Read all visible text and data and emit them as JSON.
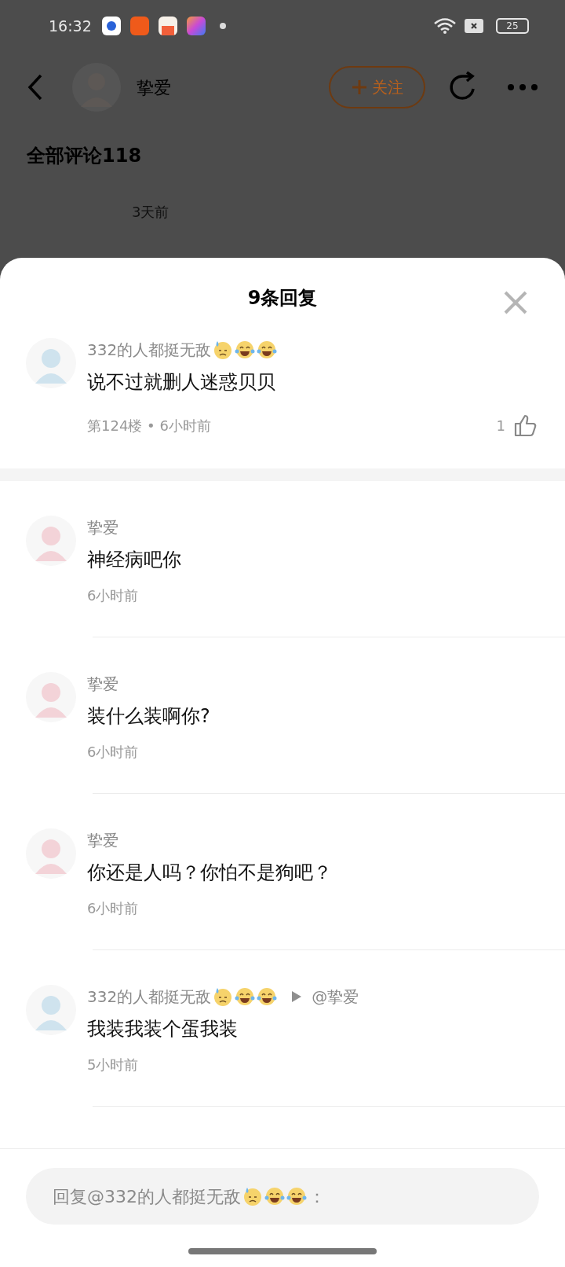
{
  "status_bar": {
    "time": "16:32",
    "battery": "25"
  },
  "header": {
    "name": "挚爱",
    "follow_button": "关注"
  },
  "page": {
    "comments_heading": "全部评论118",
    "timestamp": "3天前"
  },
  "sheet": {
    "title": "9条回复",
    "root_comment": {
      "author": "332的人都挺无敌",
      "emoji": [
        {
          "kind": "sweat"
        },
        {
          "kind": "joy"
        },
        {
          "kind": "joy"
        }
      ],
      "color": "#cfe3ee",
      "text": "说不过就删人迷惑贝贝",
      "meta": "第124楼 • 6小时前",
      "likes": "1"
    },
    "replies": [
      {
        "author": "挚爱",
        "color": "#f3d3d8",
        "text": "神经病吧你",
        "time": "6小时前"
      },
      {
        "author": "挚爱",
        "color": "#f3d3d8",
        "text": "装什么装啊你?",
        "time": "6小时前"
      },
      {
        "author": "挚爱",
        "color": "#f3d3d8",
        "text": "你还是人吗？你怕不是狗吧？",
        "time": "6小时前"
      },
      {
        "author": "332的人都挺无敌",
        "emoji": [
          {
            "kind": "sweat"
          },
          {
            "kind": "joy"
          },
          {
            "kind": "joy"
          }
        ],
        "reply_to": "@挚爱",
        "color": "#cfe3ee",
        "text": "我装我装个蛋我装",
        "time": "5小时前"
      }
    ],
    "reply_field": {
      "placeholder": "回复@332的人都挺无敌",
      "placeholder_emoji": [
        {
          "kind": "sweat"
        },
        {
          "kind": "joy"
        },
        {
          "kind": "joy"
        }
      ],
      "suffix": "："
    }
  }
}
